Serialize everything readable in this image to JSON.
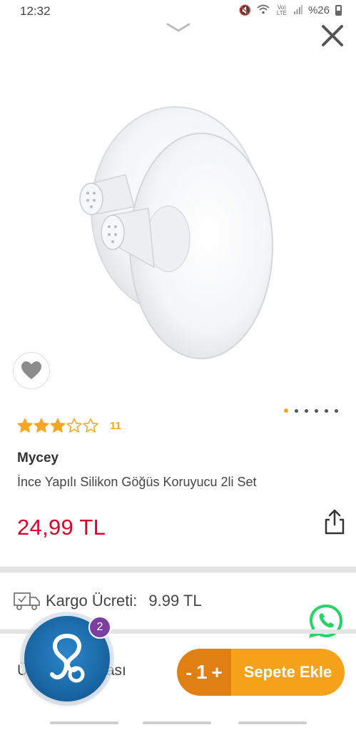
{
  "status_bar": {
    "time": "12:32",
    "network_label": "Vo) LTE",
    "battery": "%26",
    "icons": [
      "mute-icon",
      "wifi-icon",
      "volte-icon",
      "signal-icon",
      "battery-icon"
    ]
  },
  "product": {
    "brand": "Mycey",
    "title": "İnce Yapılı Silikon Göğüs Koruyucu 2li Set",
    "price": "24,99 TL",
    "rating": 3,
    "rating_max": 5,
    "rating_count": "11",
    "image_count": 6,
    "active_image": 1
  },
  "shipping": {
    "label": "Kargo Ücreti:",
    "value": "9.99 TL"
  },
  "description": {
    "label": "Ürün Açıklaması"
  },
  "assistant": {
    "badge_count": "2"
  },
  "cart": {
    "minus": "-",
    "quantity": "1",
    "plus": "+",
    "add_label": "Sepete Ekle"
  },
  "colors": {
    "price": "#d3002b",
    "accent_orange": "#f5a21b",
    "dark_orange": "#e07f12",
    "star": "#f5a623",
    "whatsapp": "#25d366"
  }
}
